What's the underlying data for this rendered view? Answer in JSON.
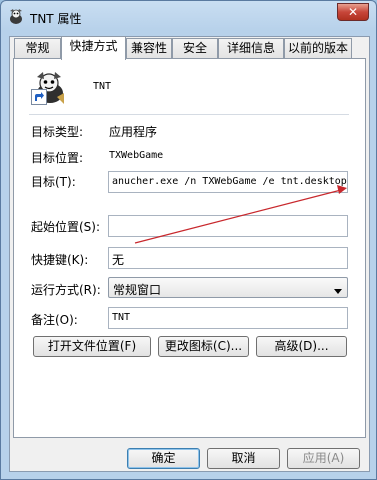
{
  "window": {
    "title": "TNT 属性",
    "close_glyph": "✕"
  },
  "tabs": [
    {
      "label": "常规",
      "active": false
    },
    {
      "label": "快捷方式",
      "active": true
    },
    {
      "label": "兼容性",
      "active": false
    },
    {
      "label": "安全",
      "active": false
    },
    {
      "label": "详细信息",
      "active": false
    },
    {
      "label": "以前的版本",
      "active": false
    }
  ],
  "shortcut": {
    "name": "TNT",
    "target_type_label": "目标类型:",
    "target_type_value": "应用程序",
    "target_location_label": "目标位置:",
    "target_location_value": "TXWebGame",
    "target_label": "目标(T):",
    "target_value": "anucher.exe /n TXWebGame /e tnt.desktop",
    "start_in_label": "起始位置(S):",
    "start_in_value": "",
    "hotkey_label": "快捷键(K):",
    "hotkey_value": "无",
    "run_label": "运行方式(R):",
    "run_value": "常规窗口",
    "comment_label": "备注(O):",
    "comment_value": "TNT"
  },
  "buttons": {
    "open_location": "打开文件位置(F)",
    "change_icon": "更改图标(C)...",
    "advanced": "高级(D)...",
    "ok": "确定",
    "cancel": "取消",
    "apply": "应用(A)"
  },
  "icons": {
    "app": "tnt-app-icon",
    "shortcut_arrow": "shortcut-arrow-icon",
    "dropdown": "chevron-down-icon"
  },
  "annotation": {
    "arrow_color": "#c8282d"
  }
}
